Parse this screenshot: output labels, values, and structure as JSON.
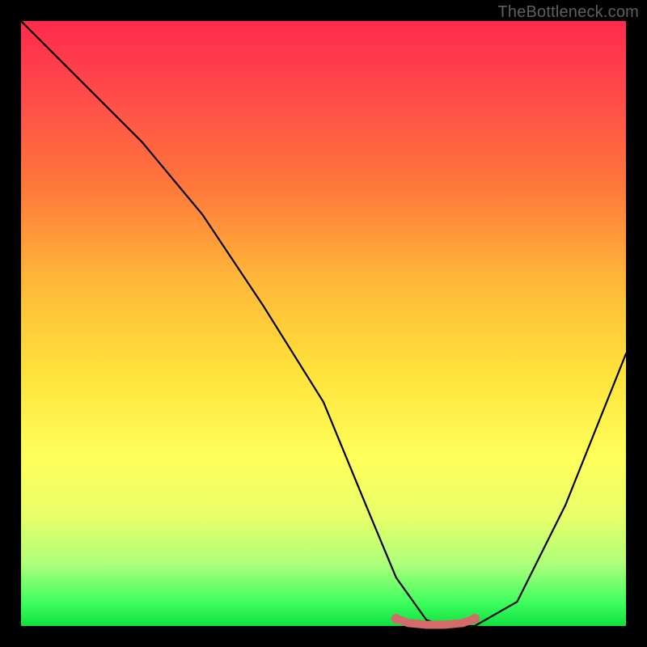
{
  "watermark": "TheBottleneck.com",
  "chart_data": {
    "type": "line",
    "title": "",
    "xlabel": "",
    "ylabel": "",
    "xlim": [
      0,
      100
    ],
    "ylim": [
      0,
      100
    ],
    "series": [
      {
        "name": "black-curve",
        "x": [
          0,
          10,
          20,
          30,
          40,
          50,
          57,
          62,
          67,
          70,
          75,
          82,
          90,
          100
        ],
        "values": [
          100,
          90,
          80,
          68,
          53,
          37,
          20,
          8,
          1,
          0,
          0,
          4,
          20,
          45
        ]
      }
    ],
    "highlight": {
      "name": "trough-marker",
      "color": "#d46a6a",
      "x": [
        62,
        64,
        67,
        70,
        73,
        75
      ],
      "values": [
        1.2,
        0.5,
        0.2,
        0.2,
        0.5,
        1.2
      ]
    },
    "background_gradient": [
      "#ff2a4d",
      "#ffff5a",
      "#10e040"
    ]
  }
}
